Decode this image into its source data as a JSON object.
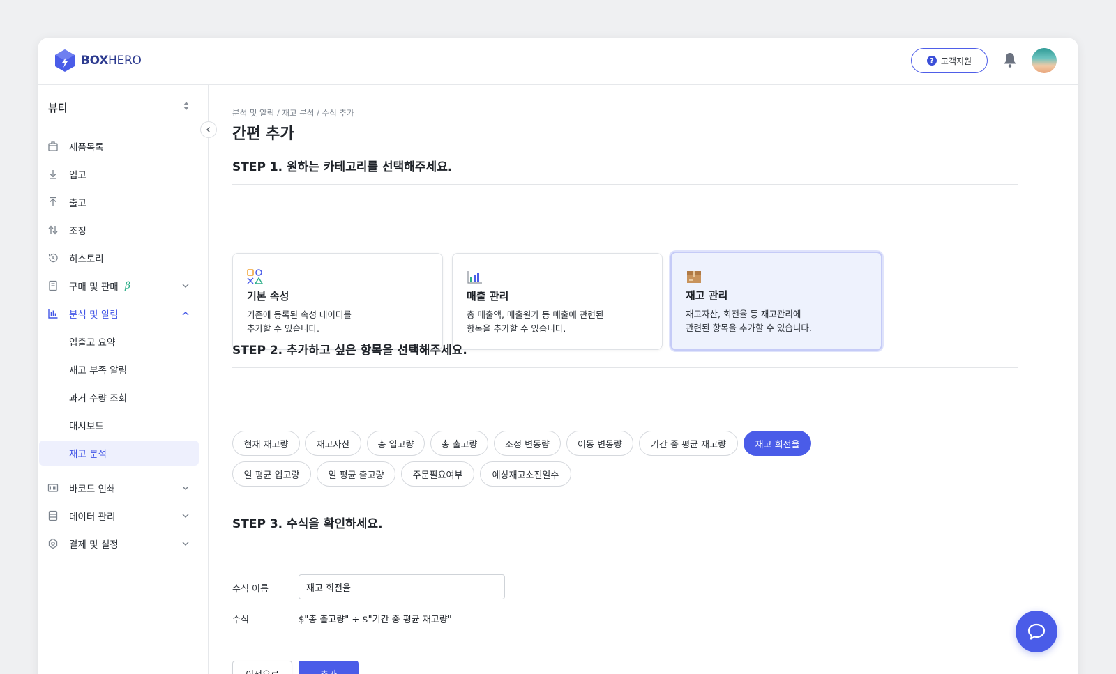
{
  "brand": {
    "name_bold": "BOX",
    "name_light": "HERO"
  },
  "header": {
    "support_label": "고객지원"
  },
  "sidebar": {
    "workspace": "뷰티",
    "items": [
      {
        "label": "제품목록",
        "icon": "box-icon"
      },
      {
        "label": "입고",
        "icon": "arrow-down-icon"
      },
      {
        "label": "출고",
        "icon": "arrow-up-icon"
      },
      {
        "label": "조정",
        "icon": "swap-icon"
      },
      {
        "label": "히스토리",
        "icon": "history-icon"
      },
      {
        "label": "구매 및 판매",
        "icon": "document-icon",
        "badge": "β"
      },
      {
        "label": "분석 및 알림",
        "icon": "bar-chart-icon"
      },
      {
        "label": "바코드 인쇄",
        "icon": "barcode-icon"
      },
      {
        "label": "데이터 관리",
        "icon": "database-icon"
      },
      {
        "label": "결제 및 설정",
        "icon": "gear-icon"
      }
    ],
    "subitems": [
      "입출고 요약",
      "재고 부족 알림",
      "과거 수량 조회",
      "대시보드",
      "재고 분석"
    ]
  },
  "main": {
    "breadcrumb": "분석 및 알림 / 재고 분석 / 수식 추가",
    "title": "간편 추가",
    "step1": "STEP 1. 원하는 카테고리를 선택해주세요.",
    "step2": "STEP 2. 추가하고 싶은 항목을 선택해주세요.",
    "step3": "STEP 3. 수식을 확인하세요.",
    "cards": [
      {
        "title": "기본 속성",
        "line1": "기존에 등록된 속성 데이터를",
        "line2": "추가할 수 있습니다."
      },
      {
        "title": "매출 관리",
        "line1": "총 매출액, 매출원가 등 매출에 관련된",
        "line2": "항목을 추가할 수 있습니다."
      },
      {
        "title": "재고 관리",
        "line1": "재고자산, 회전율 등 재고관리에",
        "line2": "관련된 항목을 추가할 수 있습니다."
      }
    ],
    "chips": [
      "현재 재고량",
      "재고자산",
      "총 입고량",
      "총 출고량",
      "조정 변동량",
      "이동 변동량",
      "기간 중 평균 재고량",
      "재고 회전율",
      "일 평균 입고량",
      "일 평균 출고량",
      "주문필요여부",
      "예상재고소진일수"
    ],
    "selected_chip": "재고 회전율",
    "form": {
      "name_label": "수식 이름",
      "name_value": "재고 회전율",
      "formula_label": "수식",
      "formula_value": "$\"총 출고량\" ÷ $\"기간 중 평균 재고량\""
    },
    "buttons": {
      "prev": "이전으로",
      "add": "추가"
    }
  },
  "colors": {
    "accent": "#4a5ce8",
    "selected_card_bg": "#eef2fd"
  }
}
